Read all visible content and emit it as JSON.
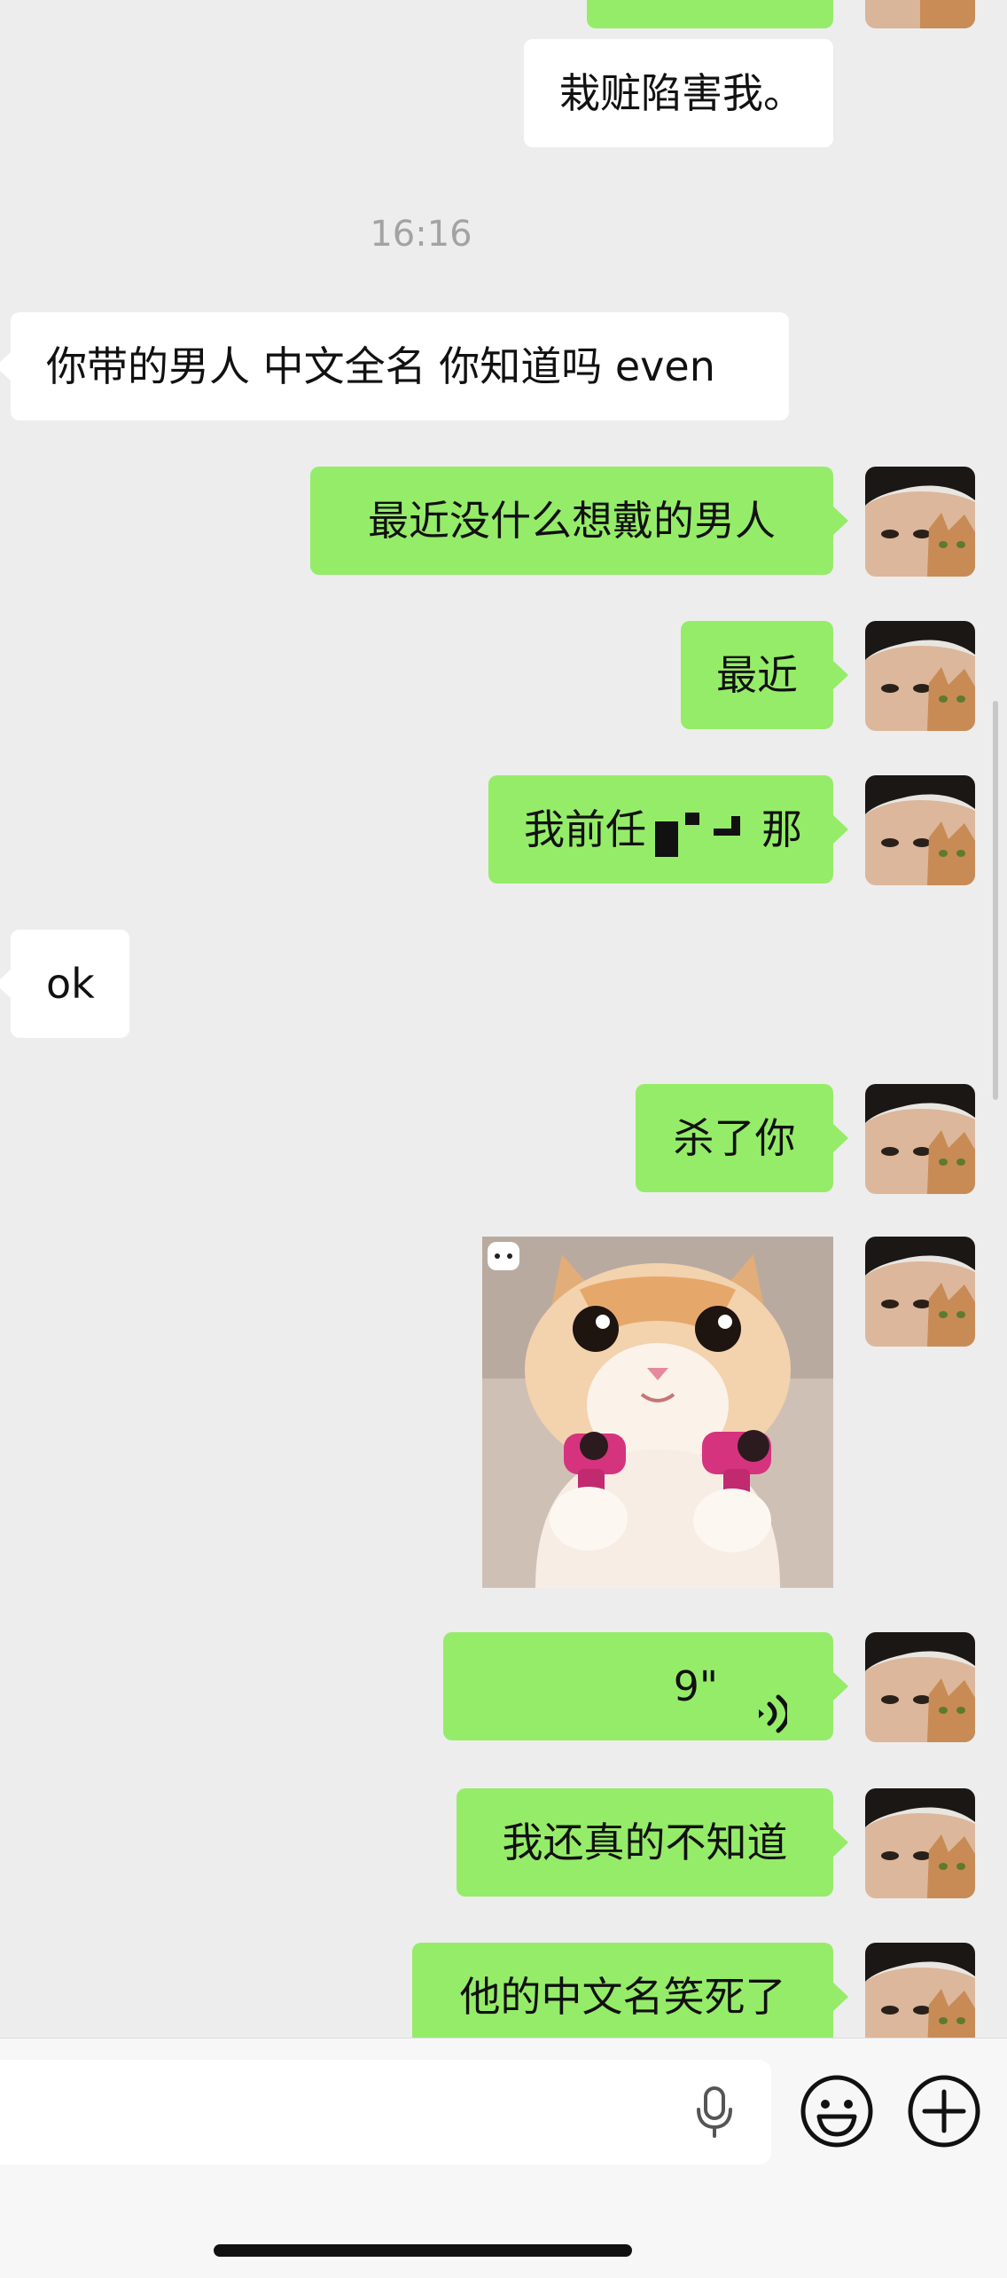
{
  "time_separator": "16:16",
  "messages": {
    "m0": "栽赃陷害我。",
    "m1": "你带的男人 中文全名 你知道吗 even",
    "m2": "最近没什么想戴的男人",
    "m3": "最近",
    "m4_prefix": "我前任",
    "m4_suffix": "那",
    "m5": "ok",
    "m6": "杀了你",
    "voice_length": "9\"",
    "m8": "我还真的不知道",
    "m9": "他的中文名笑死了"
  },
  "icons": {
    "voice": "voice-wave-icon",
    "mic": "microphone-icon",
    "emoji": "emoji-icon",
    "plus": "plus-icon"
  },
  "colors": {
    "outgoing_bubble": "#95ec69",
    "incoming_bubble": "#ffffff",
    "background": "#ededed"
  }
}
